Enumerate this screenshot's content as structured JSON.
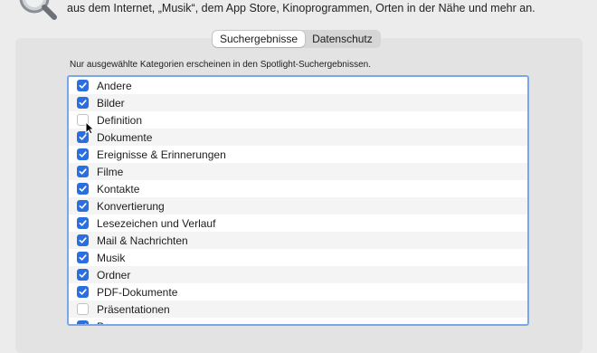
{
  "header": {
    "description": "aus dem Internet, „Musik“, dem App Store, Kinoprogrammen, Orten in der Nähe und mehr an."
  },
  "tabs": [
    {
      "label": "Suchergebnisse",
      "active": true
    },
    {
      "label": "Datenschutz",
      "active": false
    }
  ],
  "hint": "Nur ausgewählte Kategorien erscheinen in den Spotlight-Suchergebnissen.",
  "categories": [
    {
      "label": "Andere",
      "checked": true
    },
    {
      "label": "Bilder",
      "checked": true
    },
    {
      "label": "Definition",
      "checked": false
    },
    {
      "label": "Dokumente",
      "checked": true
    },
    {
      "label": "Ereignisse & Erinnerungen",
      "checked": true
    },
    {
      "label": "Filme",
      "checked": true
    },
    {
      "label": "Kontakte",
      "checked": true
    },
    {
      "label": "Konvertierung",
      "checked": true
    },
    {
      "label": "Lesezeichen und Verlauf",
      "checked": true
    },
    {
      "label": "Mail & Nachrichten",
      "checked": true
    },
    {
      "label": "Musik",
      "checked": true
    },
    {
      "label": "Ordner",
      "checked": true
    },
    {
      "label": "PDF-Dokumente",
      "checked": true
    },
    {
      "label": "Präsentationen",
      "checked": false
    },
    {
      "label": "P",
      "checked": true
    }
  ],
  "colors": {
    "accent": "#2a6fe0",
    "focus_ring": "#7aa7ea"
  }
}
